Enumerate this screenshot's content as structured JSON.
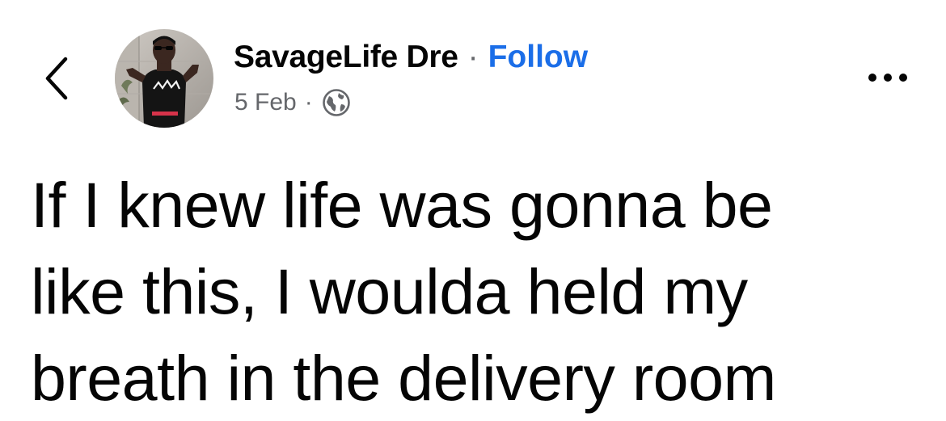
{
  "header": {
    "back_icon": "chevron-left-icon",
    "author_name": "SavageLife Dre",
    "separator": "·",
    "follow_label": "Follow",
    "date": "5 Feb",
    "meta_separator": "·",
    "privacy_icon": "globe-icon",
    "more_icon": "more-horizontal-icon",
    "follow_color": "#1b6ee8"
  },
  "post": {
    "lines": [
      "If I knew life was gonna be",
      "like this, I woulda held my",
      "breath in the delivery room"
    ]
  }
}
